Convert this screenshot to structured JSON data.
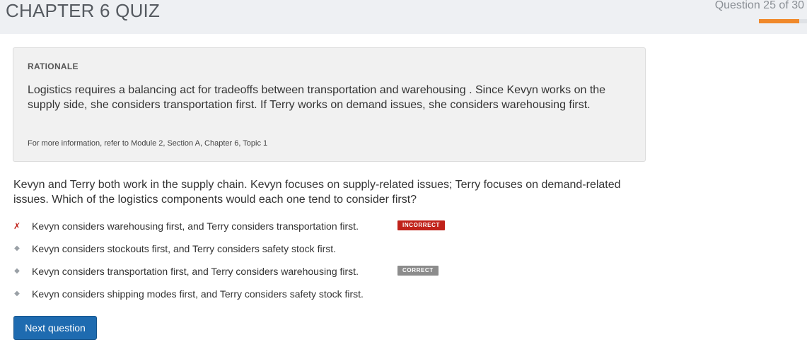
{
  "header": {
    "title": "CHAPTER 6 QUIZ",
    "counter": "Question 25 of 30",
    "progress": 0.833,
    "progress_color": "#f0892b"
  },
  "rationale": {
    "heading": "RATIONALE",
    "text": "Logistics requires a balancing act for tradeoffs between transportation and warehousing . Since Kevyn works on the supply side, she considers transportation first. If Terry works on demand issues, she considers warehousing first.",
    "reference": "For more information, refer to Module 2, Section A, Chapter 6, Topic 1"
  },
  "question": {
    "text": "Kevyn and Terry both work in the supply chain. Kevyn focuses on supply-related issues; Terry focuses on demand-related issues. Which of the logistics components would each one tend to consider first?"
  },
  "options": [
    {
      "marker": "✗",
      "marker_icon": "x-mark-icon",
      "text": "Kevyn considers warehousing first, and Terry considers transportation first.",
      "badge": "INCORRECT"
    },
    {
      "marker": "◆",
      "marker_icon": "diamond-bullet-icon",
      "text": "Kevyn considers stockouts first, and Terry considers safety stock first."
    },
    {
      "marker": "◆",
      "marker_icon": "diamond-bullet-icon",
      "text": "Kevyn considers transportation first, and Terry considers warehousing first.",
      "badge": "CORRECT"
    },
    {
      "marker": "◆",
      "marker_icon": "diamond-bullet-icon",
      "text": "Kevyn considers shipping modes first, and Terry considers safety stock first."
    }
  ],
  "actions": {
    "next_label": "Next question",
    "next_color": "#1e6bb0"
  },
  "colors": {
    "incorrect": "#c0221a",
    "correct_badge": "#8c8c8c"
  }
}
